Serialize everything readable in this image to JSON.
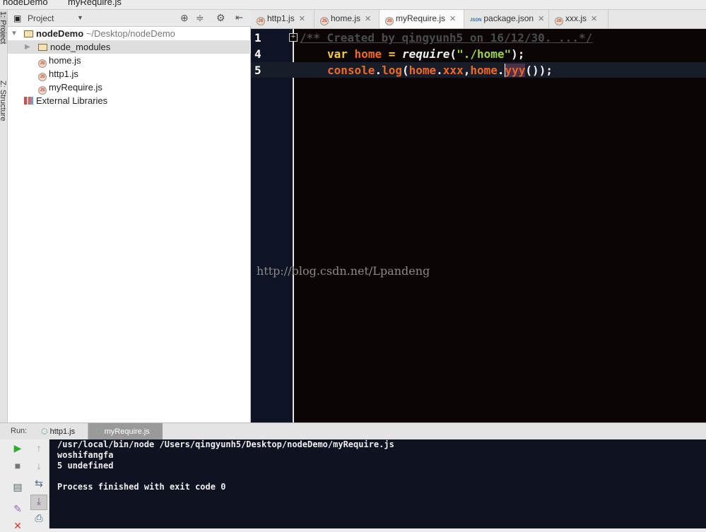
{
  "breadcrumb": [
    "nodeDemo",
    "myRequire.js"
  ],
  "side_tabs": [
    "1: Project",
    "Z: Structure"
  ],
  "project_panel": {
    "title": "Project"
  },
  "tree": {
    "root": "nodeDemo",
    "root_path": "~/Desktop/nodeDemo",
    "items": [
      "node_modules",
      "home.js",
      "http1.js",
      "myRequire.js"
    ],
    "external": "External Libraries"
  },
  "tabs": [
    "http1.js",
    "home.js",
    "myRequire.js",
    "package.json",
    "xxx.js"
  ],
  "active_tab": "myRequire.js",
  "editor": {
    "line_numbers": [
      "1",
      "4",
      "5"
    ],
    "line1": "/** Created by qingyunh5 on 16/12/30. ...*/",
    "line4": {
      "kw": "var",
      "var": "home",
      "eq": " = ",
      "fn": "require",
      "p1": "(",
      "str": "\"./home\"",
      "p2": ");"
    },
    "line5": {
      "a": "console",
      "dot1": ".",
      "b": "log",
      "p1": "(",
      "c": "home",
      "dot2": ".",
      "d": "xxx",
      "comma": ",",
      "e": "home",
      "dot3": ".",
      "f": "yyy",
      "p2": "());"
    }
  },
  "watermark": "http://blog.csdn.net/Lpandeng",
  "run": {
    "label": "Run:",
    "tabs": [
      "http1.js",
      "myRequire.js"
    ]
  },
  "console": [
    "/usr/local/bin/node /Users/qingyunh5/Desktop/nodeDemo/myRequire.js",
    "woshifangfa",
    "5 undefined",
    "",
    "Process finished with exit code 0"
  ]
}
